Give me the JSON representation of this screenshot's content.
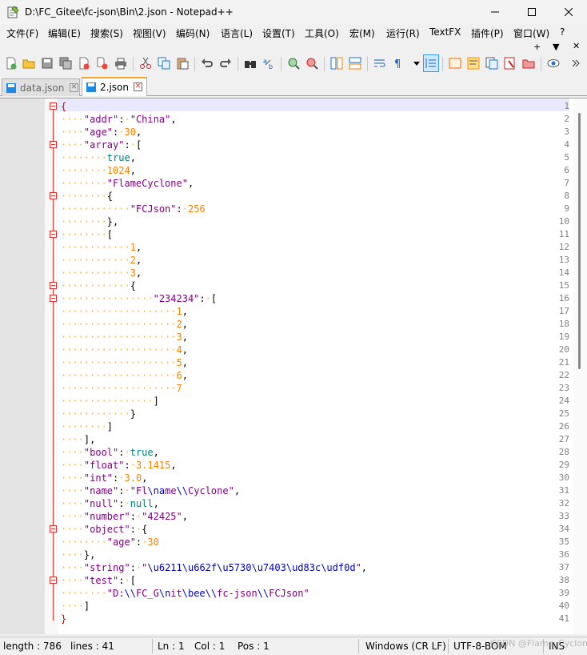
{
  "window": {
    "title": "D:\\FC_Gitee\\fc-json\\Bin\\2.json - Notepad++"
  },
  "menu": {
    "items": [
      "文件(F)",
      "编辑(E)",
      "搜索(S)",
      "视图(V)",
      "编码(N)",
      "语言(L)",
      "设置(T)",
      "工具(O)",
      "宏(M)",
      "运行(R)",
      "TextFX",
      "插件(P)",
      "窗口(W)",
      "?"
    ],
    "extra_plus": "+",
    "extra_down": "▼",
    "extra_close": "✕"
  },
  "toolbar": {
    "buttons": [
      "new-file",
      "open-file",
      "save",
      "save-all",
      "close",
      "close-all",
      "print",
      "cut",
      "copy",
      "paste",
      "undo",
      "redo",
      "find",
      "replace",
      "zoom-in",
      "zoom-out",
      "sync-v",
      "sync-h",
      "word-wrap",
      "show-all-chars",
      "indent-guide",
      "udl",
      "doc-map",
      "function-list",
      "folder-workspace",
      "monitoring",
      "macro-record",
      "view"
    ]
  },
  "tabs": [
    {
      "label": "data.json",
      "active": false
    },
    {
      "label": "2.json",
      "active": true
    }
  ],
  "editor": {
    "line_numbers": [
      "1",
      "2",
      "3",
      "4",
      "5",
      "6",
      "7",
      "8",
      "9",
      "10",
      "11",
      "12",
      "13",
      "14",
      "15",
      "16",
      "17",
      "18",
      "19",
      "20",
      "21",
      "22",
      "23",
      "24",
      "25",
      "26",
      "27",
      "28",
      "29",
      "30",
      "31",
      "32",
      "33",
      "34",
      "35",
      "36",
      "37",
      "38",
      "39",
      "40",
      "41"
    ],
    "lines": [
      "{",
      "\"addr\": \"China\",",
      "\"age\": 30,",
      "\"array\": [",
      "true,",
      "1024,",
      "\"FlameCyclone\",",
      "{",
      "\"FCJson\": 256",
      "},",
      "[",
      "1,",
      "2,",
      "3,",
      "{",
      "\"234234\": [",
      "1,",
      "2,",
      "3,",
      "4,",
      "5,",
      "6,",
      "7",
      "]",
      "}",
      "]",
      "],",
      "\"bool\": true,",
      "\"float\": 3.1415,",
      "\"int\": 3.0,",
      "\"name\": \"Fl\\name\\\\Cyclone\",",
      "\"null\": null,",
      "\"number\": \"42425\",",
      "\"object\": {",
      "\"age\": 30",
      "},",
      "\"string\": \"\\u6211\\u662f\\u5730\\u7403\\ud83c\\udf0d\",",
      "\"test\": [",
      "\"D:\\\\FC_G\\nit\\bee\\\\fc-json\\\\FCJson\"",
      "]",
      "}"
    ]
  },
  "status": {
    "length": "length : 786",
    "lines": "lines : 41",
    "ln": "Ln : 1",
    "col": "Col : 1",
    "pos": "Pos : 1",
    "eol": "Windows (CR LF)",
    "encoding": "UTF-8-BOM",
    "mode": "INS"
  },
  "watermark": "CSDN @Flame_Cyclone"
}
